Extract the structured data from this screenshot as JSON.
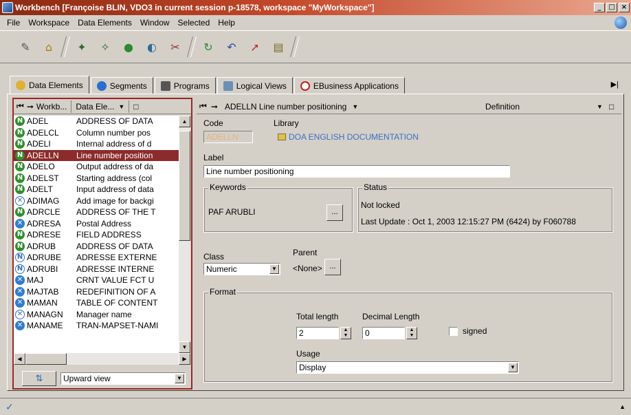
{
  "window": {
    "title": "Workbench [Françoise BLIN, VDO3 in current session p-18578, workspace \"MyWorkspace\"]",
    "minimize": "_",
    "maximize": "□",
    "close": "×"
  },
  "menu": [
    "File",
    "Workspace",
    "Data Elements",
    "Window",
    "Selected",
    "Help"
  ],
  "tabs": [
    {
      "label": "Data Elements",
      "active": true
    },
    {
      "label": "Segments"
    },
    {
      "label": "Programs"
    },
    {
      "label": "Logical Views"
    },
    {
      "label": "EBusiness Applications"
    }
  ],
  "left_pane": {
    "col1": "Workb...",
    "col2": "Data Ele...",
    "rows": [
      {
        "icon": "n",
        "code": "ADEL",
        "desc": "ADDRESS OF DATA"
      },
      {
        "icon": "n",
        "code": "ADELCL",
        "desc": "Column number pos"
      },
      {
        "icon": "n",
        "code": "ADELI",
        "desc": "Internal address of d"
      },
      {
        "icon": "n",
        "code": "ADELLN",
        "desc": "Line number position",
        "selected": true
      },
      {
        "icon": "n",
        "code": "ADELO",
        "desc": "Output address of da"
      },
      {
        "icon": "n",
        "code": "ADELST",
        "desc": "Starting address (col"
      },
      {
        "icon": "n",
        "code": "ADELT",
        "desc": "Input address of data"
      },
      {
        "icon": "xh",
        "code": "ADIMAG",
        "desc": "Add image for backgi"
      },
      {
        "icon": "n",
        "code": "ADRCLE",
        "desc": "ADDRESS OF THE T"
      },
      {
        "icon": "x",
        "code": "ADRESA",
        "desc": "Postal Address"
      },
      {
        "icon": "n",
        "code": "ADRESE",
        "desc": "FIELD ADDRESS"
      },
      {
        "icon": "n",
        "code": "ADRUB",
        "desc": "ADDRESS OF DATA"
      },
      {
        "icon": "nh",
        "code": "ADRUBE",
        "desc": "ADRESSE EXTERNE"
      },
      {
        "icon": "nh",
        "code": "ADRUBI",
        "desc": "ADRESSE INTERNE"
      },
      {
        "icon": "x",
        "code": "MAJ",
        "desc": "CRNT VALUE FCT U"
      },
      {
        "icon": "x",
        "code": "MAJTAB",
        "desc": "REDEFINITION OF A"
      },
      {
        "icon": "x",
        "code": "MAMAN",
        "desc": "TABLE OF CONTENT"
      },
      {
        "icon": "xh",
        "code": "MANAGN",
        "desc": "Manager name"
      },
      {
        "icon": "x",
        "code": "MANAME",
        "desc": "TRAN-MAPSET-NAMI"
      }
    ],
    "view_select": "Upward view"
  },
  "right_pane": {
    "header_title": "ADELLN Line number positioning",
    "header_mode": "Definition",
    "code_label": "Code",
    "code_value": "ADELLN",
    "library_label": "Library",
    "library_value": "DOA ENGLISH DOCUMENTATION",
    "label_label": "Label",
    "label_value": "Line number positioning",
    "keywords_title": "Keywords",
    "keywords_value": "PAF ARUBLI",
    "ellipsis": "...",
    "status_title": "Status",
    "status_lock": "Not locked",
    "status_update": "Last Update : Oct 1, 2003 12:15:27 PM (6424) by F060788",
    "class_label": "Class",
    "class_value": "Numeric",
    "parent_label": "Parent",
    "parent_value": "<None>",
    "format_title": "Format",
    "total_length_label": "Total length",
    "total_length_value": "2",
    "decimal_length_label": "Decimal Length",
    "decimal_length_value": "0",
    "signed_label": "signed",
    "usage_label": "Usage",
    "usage_value": "Display"
  },
  "status": {
    "check": "✓"
  },
  "colors": {
    "selection": "#8b2b2b",
    "library_link": "#3a6fc4",
    "code_disabled": "#e8b07a"
  }
}
